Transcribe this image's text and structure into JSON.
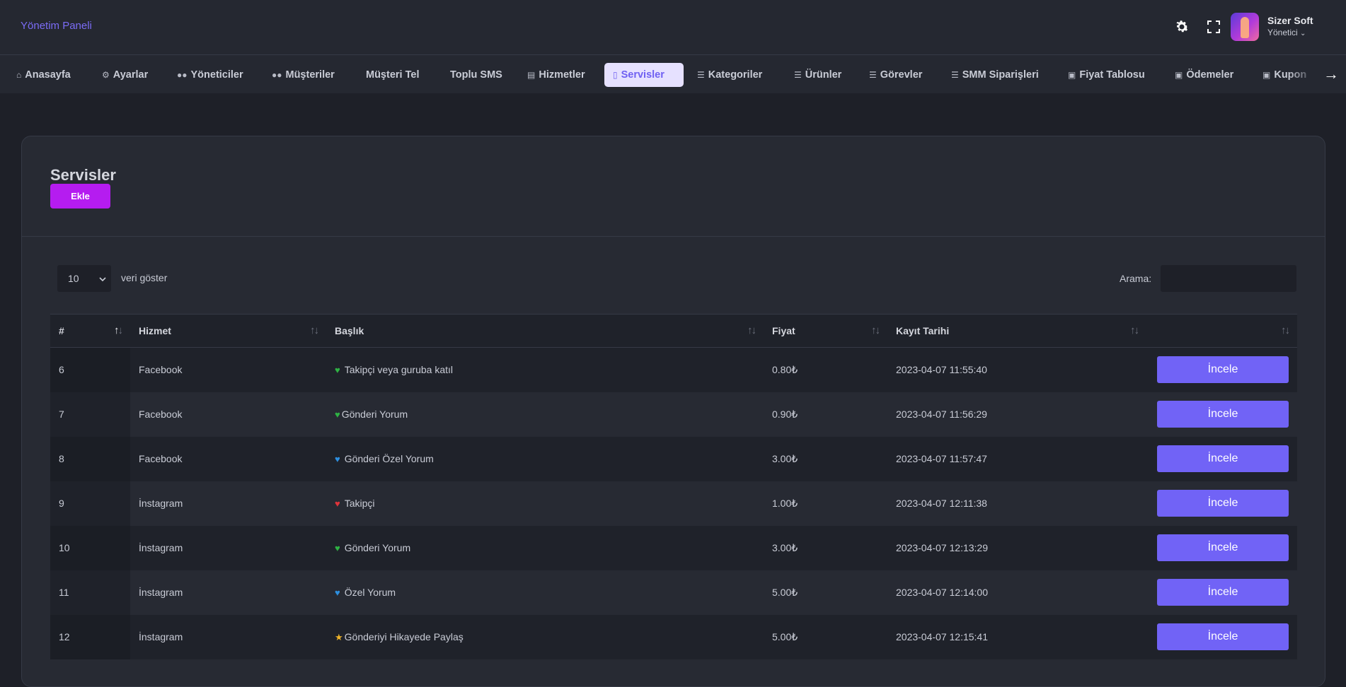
{
  "header": {
    "brand": "Yönetim Paneli",
    "user_name": "Sizer Soft",
    "user_role": "Yönetici"
  },
  "nav": {
    "items": [
      {
        "label": "Anasayfa",
        "icon": "home-icon"
      },
      {
        "label": "Ayarlar",
        "icon": "cogs-icon"
      },
      {
        "label": "Yöneticiler",
        "icon": "users-icon"
      },
      {
        "label": "Müşteriler",
        "icon": "users-icon"
      },
      {
        "label": "Müşteri Tel",
        "icon": ""
      },
      {
        "label": "Toplu SMS",
        "icon": ""
      },
      {
        "label": "Hizmetler",
        "icon": "building-icon"
      },
      {
        "label": "Servisler",
        "icon": "file-icon",
        "active": true
      },
      {
        "label": "Kategoriler",
        "icon": "list-icon"
      },
      {
        "label": "Ürünler",
        "icon": "bars-icon"
      },
      {
        "label": "Görevler",
        "icon": "list-icon"
      },
      {
        "label": "SMM Siparişleri",
        "icon": "list-icon"
      },
      {
        "label": "Fiyat Tablosu",
        "icon": "money-icon"
      },
      {
        "label": "Ödemeler",
        "icon": "money-icon"
      },
      {
        "label": "Kupon",
        "icon": "money-icon"
      }
    ]
  },
  "page": {
    "title": "Servisler",
    "add_label": "Ekle",
    "page_length": "10",
    "page_length_label": "veri göster",
    "search_label": "Arama:",
    "search_value": ""
  },
  "table": {
    "headers": [
      "#",
      "Hizmet",
      "Başlık",
      "Fiyat",
      "Kayıt Tarihi",
      ""
    ],
    "view_label": "İncele",
    "rows": [
      {
        "id": "6",
        "service": "Facebook",
        "title": "Takipçi veya guruba katıl",
        "marker": "♥",
        "marker_color": "#2fb344",
        "price": "0.80₺",
        "date": "2023-04-07 11:55:40"
      },
      {
        "id": "7",
        "service": "Facebook",
        "title": "Gönderi Yorum",
        "marker": "♥",
        "marker_color": "#2fb344",
        "price": "0.90₺",
        "date": "2023-04-07 11:56:29"
      },
      {
        "id": "8",
        "service": "Facebook",
        "title": "Gönderi Özel Yorum",
        "marker": "♥",
        "marker_color": "#2d8fe0",
        "price": "3.00₺",
        "date": "2023-04-07 11:57:47"
      },
      {
        "id": "9",
        "service": "İnstagram",
        "title": "Takipçi",
        "marker": "♥",
        "marker_color": "#e0343b",
        "price": "1.00₺",
        "date": "2023-04-07 12:11:38"
      },
      {
        "id": "10",
        "service": "İnstagram",
        "title": "Gönderi Yorum",
        "marker": "♥",
        "marker_color": "#2fb344",
        "price": "3.00₺",
        "date": "2023-04-07 12:13:29"
      },
      {
        "id": "11",
        "service": "İnstagram",
        "title": "Özel Yorum",
        "marker": "♥",
        "marker_color": "#2d8fe0",
        "price": "5.00₺",
        "date": "2023-04-07 12:14:00"
      },
      {
        "id": "12",
        "service": "İnstagram",
        "title": "Gönderiyi Hikayede Paylaş",
        "marker": "★",
        "marker_color": "#f0b429",
        "price": "5.00₺",
        "date": "2023-04-07 12:15:41"
      }
    ]
  }
}
